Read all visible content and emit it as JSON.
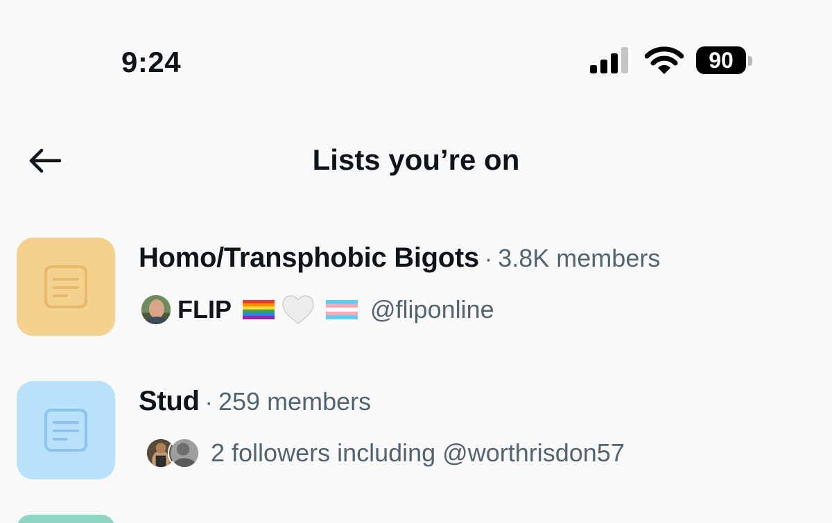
{
  "status_bar": {
    "time": "9:24",
    "battery": "90"
  },
  "header": {
    "title": "Lists you’re on",
    "back_icon": "arrow-left-icon"
  },
  "lists": [
    {
      "name": "Homo/Transphobic Bigots",
      "separator": "·",
      "members": "3.8K members",
      "owner_name": "FLIP",
      "owner_handle": "@fliponline",
      "owner_emoji": [
        "rainbow-flag-icon",
        "white-heart-icon",
        "transgender-flag-icon"
      ],
      "thumb_color": "#f2d28e",
      "icon_color": "#e8b869"
    },
    {
      "name": "Stud",
      "separator": "·",
      "members": "259 members",
      "followers_text": "2 followers including @worthrisdon57",
      "thumb_color": "#b9e1fb",
      "icon_color": "#8cc4ef"
    }
  ],
  "colors": {
    "background": "#f9f9f9",
    "text_primary": "#0f1419",
    "text_secondary": "#536471",
    "next_thumb": "#8fd6c2"
  }
}
